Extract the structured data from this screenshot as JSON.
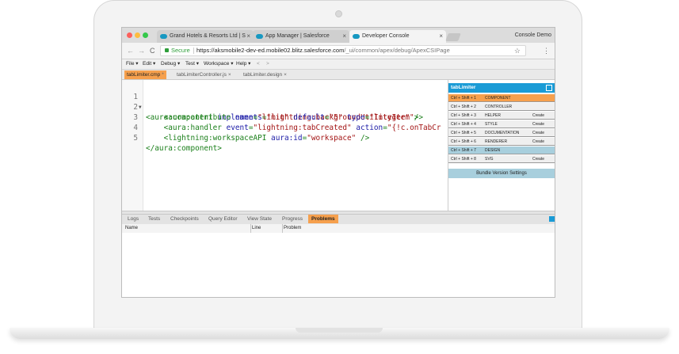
{
  "browser": {
    "tabs": [
      {
        "label": "Grand Hotels & Resorts Ltd | S"
      },
      {
        "label": "App Manager | Salesforce"
      },
      {
        "label": "Developer Console"
      }
    ],
    "tab_close": "×",
    "profile": "Console Demo",
    "back": "←",
    "forward": "→",
    "reload": "C",
    "secure_label": "Secure",
    "url_host": "https://aksmobile2-dev-ed.mobile02.blitz.salesforce.com",
    "url_path": "/_ui/common/apex/debug/ApexCSIPage",
    "star": "☆",
    "menu": "⋮"
  },
  "menu": {
    "items": [
      "File ▾",
      "Edit ▾",
      "Debug ▾",
      "Test ▾",
      "Workspace ▾",
      "Help ▾",
      "<",
      ">"
    ]
  },
  "file_tabs": [
    {
      "label": "tabLimiter.cmp",
      "close": "*"
    },
    {
      "label": "tabLimiterController.js",
      "close": "×"
    },
    {
      "label": "tabLimiter.design",
      "close": "×"
    }
  ],
  "editor": {
    "line_numbers": [
      "1",
      "2",
      "3",
      "4",
      "5"
    ],
    "fold": "▼",
    "l1": {
      "t1": "<aura:component",
      "a1": " implements",
      "p1": "=",
      "s1": "\"lightning:backgroundUtilityItem\"",
      "t2": ">"
    },
    "l2": {
      "t1": "    <aura:attribute",
      "a1": " name",
      "p1": "=",
      "s1": "\"limit\"",
      "a2": " default",
      "p2": "=",
      "s2": "\"5\"",
      "a3": " type",
      "p3": "=",
      "s3": "\"Integer\"",
      "t2": " />"
    },
    "l3": {
      "t1": "    <aura:handler",
      "a1": " event",
      "p1": "=",
      "s1": "\"lightning:tabCreated\"",
      "a2": " action",
      "p2": "=",
      "s2": "\"{!c.onTabCr"
    },
    "l4": {
      "t1": "    <lightning:workspaceAPI",
      "a1": " aura:id",
      "p1": "=",
      "s1": "\"workspace\"",
      "t2": " />"
    },
    "l5": {
      "t1": "</aura:component>"
    }
  },
  "sidebar": {
    "title": "tabLimiter",
    "rows": [
      {
        "key": "Ctrl + Shift + 1",
        "name": "COMPONENT",
        "action": ""
      },
      {
        "key": "Ctrl + Shift + 2",
        "name": "CONTROLLER",
        "action": ""
      },
      {
        "key": "Ctrl + Shift + 3",
        "name": "HELPER",
        "action": "Create"
      },
      {
        "key": "Ctrl + Shift + 4",
        "name": "STYLE",
        "action": "Create"
      },
      {
        "key": "Ctrl + Shift + 5",
        "name": "DOCUMENTATION",
        "action": "Create"
      },
      {
        "key": "Ctrl + Shift + 6",
        "name": "RENDERER",
        "action": "Create"
      },
      {
        "key": "Ctrl + Shift + 7",
        "name": "DESIGN",
        "action": ""
      },
      {
        "key": "Ctrl + Shift + 8",
        "name": "SVG",
        "action": "Create"
      }
    ],
    "bundle": "Bundle Version Settings"
  },
  "panel": {
    "tabs": [
      "Logs",
      "Tests",
      "Checkpoints",
      "Query Editor",
      "View State",
      "Progress",
      "Problems"
    ],
    "columns": [
      "Name",
      "Line",
      "Problem"
    ]
  }
}
